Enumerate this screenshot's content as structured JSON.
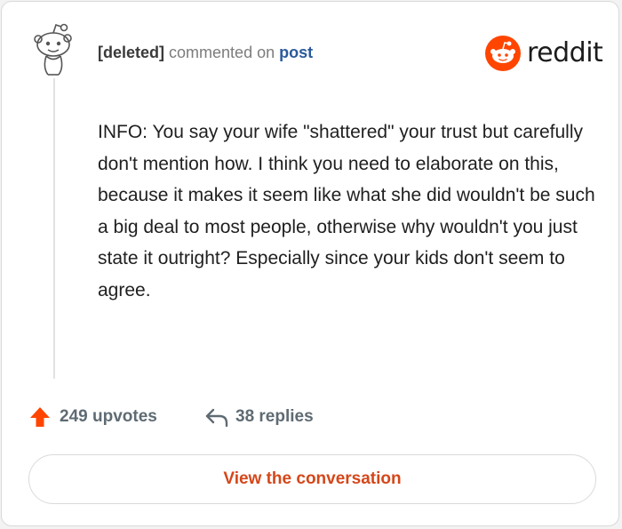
{
  "header": {
    "author": "[deleted]",
    "action_text": "commented on",
    "post_link": "post"
  },
  "brand": {
    "wordmark": "reddit",
    "logo_icon": "reddit-alien-icon",
    "accent_color": "#ff4500"
  },
  "avatar": {
    "icon": "snoo-outline-icon"
  },
  "comment": {
    "body": "INFO: You say your wife \"shattered\" your trust but carefully don't mention how. I think you need to elaborate on this, because it makes it seem like what she did wouldn't be such a big deal to most people, otherwise why wouldn't you just state it outright? Especially since your kids don't seem to agree."
  },
  "actions": {
    "upvote_icon": "upvote-arrow-icon",
    "upvotes_label": "249 upvotes",
    "reply_icon": "reply-arrow-icon",
    "replies_label": "38 replies"
  },
  "cta": {
    "label": "View the conversation",
    "color": "#d5471a"
  }
}
